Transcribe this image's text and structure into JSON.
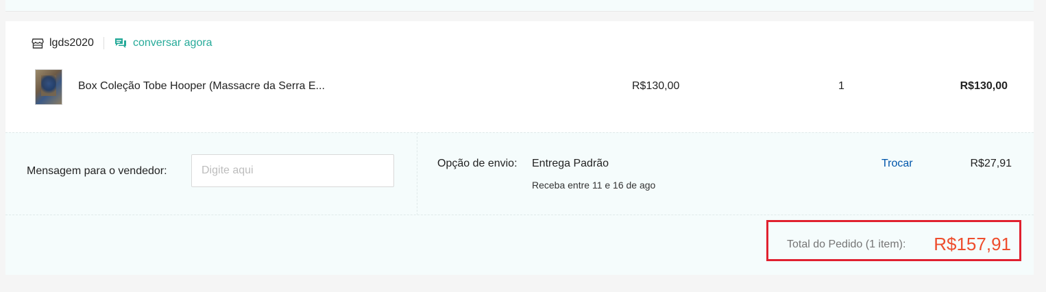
{
  "shop": {
    "name": "lgds2020",
    "chat_label": "conversar agora"
  },
  "item": {
    "name": "Box Coleção Tobe Hooper (Massacre da Serra E...",
    "unit_price": "R$130,00",
    "quantity": "1",
    "subtotal": "R$130,00"
  },
  "message": {
    "label": "Mensagem para o vendedor:",
    "placeholder": "Digite aqui"
  },
  "shipping": {
    "label": "Opção de envio:",
    "option": "Entrega Padrão",
    "eta": "Receba entre 11 e 16 de ago",
    "change_label": "Trocar",
    "price": "R$27,91"
  },
  "total": {
    "label": "Total do Pedido (1 item):",
    "value": "R$157,91"
  },
  "colors": {
    "accent_green": "#26aa99",
    "link_blue": "#0055aa",
    "price_orange": "#ee4d2d",
    "highlight_red": "#e0212f"
  }
}
